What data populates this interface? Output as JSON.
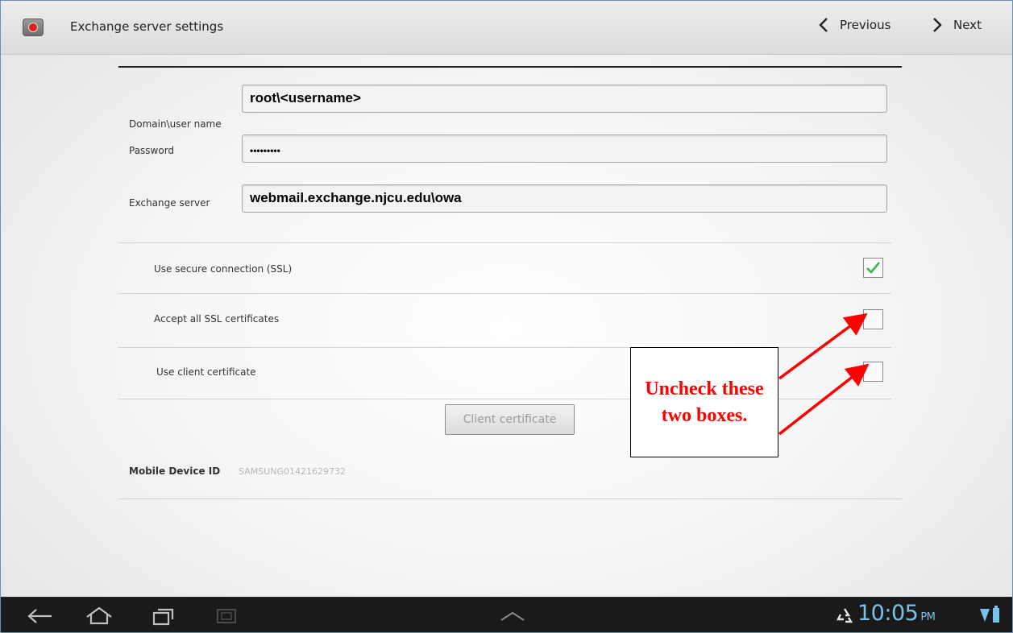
{
  "header": {
    "title": "Exchange server settings",
    "previous_label": "Previous",
    "next_label": "Next"
  },
  "form": {
    "username": {
      "label": "Domain\\user name",
      "value": "root\\<username>"
    },
    "password": {
      "label": "Password",
      "value": "•••••••••"
    },
    "server": {
      "label": "Exchange server",
      "value": "webmail.exchange.njcu.edu\\owa"
    }
  },
  "options": [
    {
      "label": "Use secure connection (SSL)",
      "checked": true
    },
    {
      "label": "Accept all SSL certificates",
      "checked": false
    },
    {
      "label": "Use client certificate",
      "checked": false
    }
  ],
  "client_certificate_button": "Client certificate",
  "device": {
    "label": "Mobile Device ID",
    "value": "SAMSUNG01421629732"
  },
  "annotation": {
    "text": "Uncheck these two boxes.",
    "color": "#ff0000"
  },
  "status_bar": {
    "time": "10:05",
    "ampm": "PM",
    "accent": "#7ac3e8"
  },
  "icons": {
    "app": "email-app-icon",
    "previous": "chevron-left-icon",
    "next": "chevron-right-icon",
    "back": "back-arrow-icon",
    "home": "home-icon",
    "recent": "recent-apps-icon",
    "screenshot": "screenshot-icon",
    "up": "chevron-up-icon",
    "recycle": "recycle-icon",
    "wifi": "wifi-icon",
    "battery": "battery-icon"
  }
}
